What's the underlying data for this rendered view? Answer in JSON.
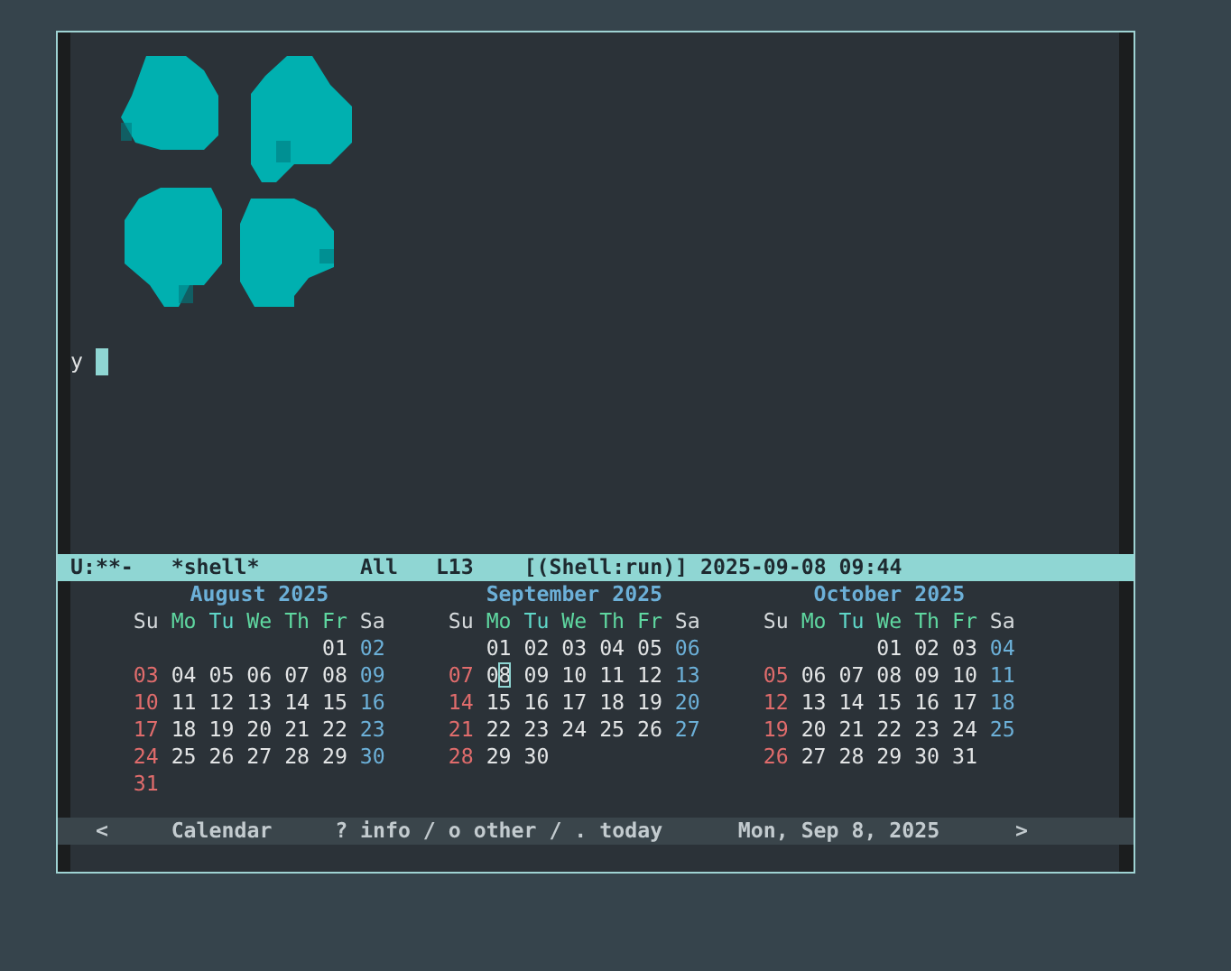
{
  "shell": {
    "prompt": "y",
    "cursor": true
  },
  "mode_line": {
    "status": "U:**-",
    "buffer": "*shell*",
    "position": "All",
    "line": "L13",
    "mode": "[(Shell:run)]",
    "datetime": "2025-09-08 09:44"
  },
  "calendar": {
    "months": [
      {
        "title": "August 2025",
        "weekdays": [
          "Su",
          "Mo",
          "Tu",
          "We",
          "Th",
          "Fr",
          "Sa"
        ],
        "weeks": [
          [
            "01",
            "02"
          ],
          [
            "03",
            "04",
            "05",
            "06",
            "07",
            "08",
            "09"
          ],
          [
            "10",
            "11",
            "12",
            "13",
            "14",
            "15",
            "16"
          ],
          [
            "17",
            "18",
            "19",
            "20",
            "21",
            "22",
            "23"
          ],
          [
            "24",
            "25",
            "26",
            "27",
            "28",
            "29",
            "30"
          ],
          [
            "31"
          ]
        ]
      },
      {
        "title": "September 2025",
        "weekdays": [
          "Su",
          "Mo",
          "Tu",
          "We",
          "Th",
          "Fr",
          "Sa"
        ],
        "weeks": [
          [
            "01",
            "02",
            "03",
            "04",
            "05",
            "06"
          ],
          [
            "07",
            {
              "day": "08",
              "cursor": true
            },
            "09",
            "10",
            "11",
            "12",
            "13"
          ],
          [
            "14",
            "15",
            "16",
            "17",
            "18",
            "19",
            "20"
          ],
          [
            "21",
            "22",
            "23",
            "24",
            "25",
            "26",
            "27"
          ],
          [
            "28",
            "29",
            "30"
          ]
        ]
      },
      {
        "title": "October 2025",
        "weekdays": [
          "Su",
          "Mo",
          "Tu",
          "We",
          "Th",
          "Fr",
          "Sa"
        ],
        "weeks": [
          [
            "01",
            "02",
            "03",
            "04"
          ],
          [
            "05",
            "06",
            "07",
            "08",
            "09",
            "10",
            "11"
          ],
          [
            "12",
            "13",
            "14",
            "15",
            "16",
            "17",
            "18"
          ],
          [
            "19",
            "20",
            "21",
            "22",
            "23",
            "24",
            "25"
          ],
          [
            "26",
            "27",
            "28",
            "29",
            "30",
            "31"
          ]
        ]
      }
    ]
  },
  "header_line": {
    "prev": "<",
    "title": "Calendar",
    "help": "? info / o other / . today",
    "date": "Mon, Sep 8, 2025",
    "next": ">"
  }
}
